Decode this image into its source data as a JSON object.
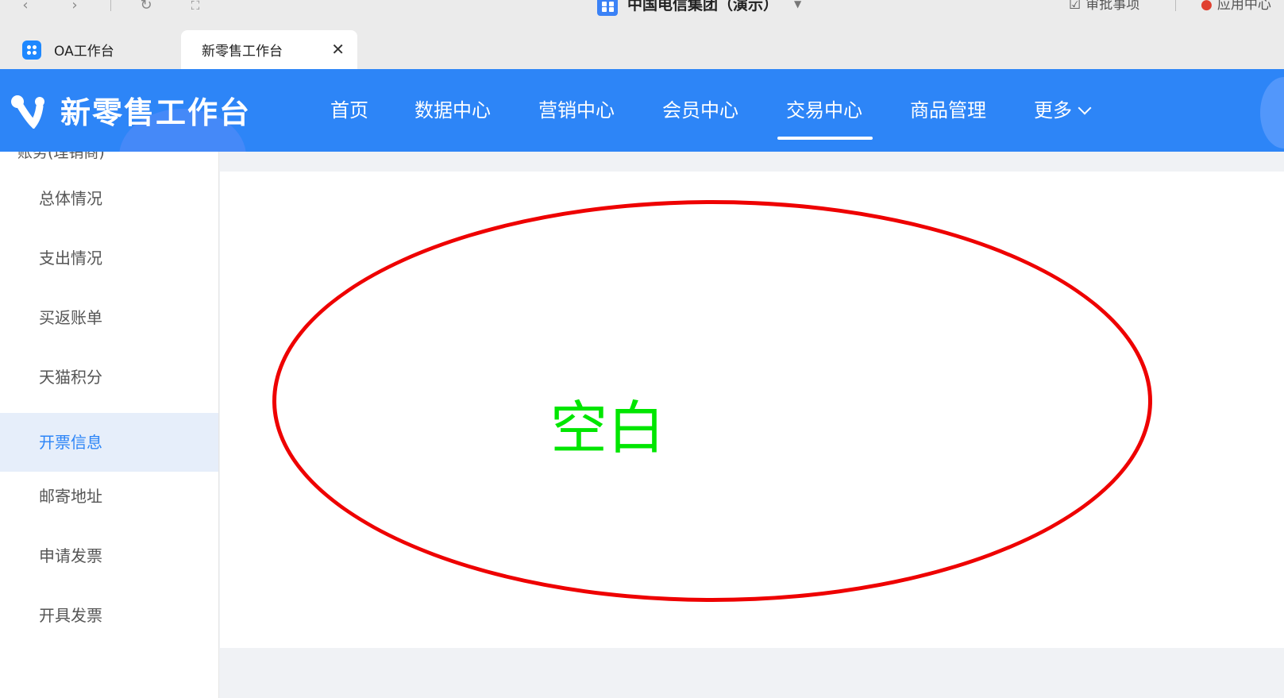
{
  "window": {
    "title": "中国电信集团（演示）",
    "right_items": [
      "审批事项",
      "应用中心"
    ]
  },
  "tabs": [
    {
      "label": "OA工作台",
      "active": false
    },
    {
      "label": "新零售工作台",
      "active": true
    }
  ],
  "header": {
    "app_name": "新零售工作台",
    "nav": [
      {
        "label": "首页"
      },
      {
        "label": "数据中心"
      },
      {
        "label": "营销中心"
      },
      {
        "label": "会员中心"
      },
      {
        "label": "交易中心",
        "active": true
      },
      {
        "label": "商品管理"
      },
      {
        "label": "更多"
      }
    ]
  },
  "sidebar": {
    "cut_off_label": "账务(理销商)",
    "items": [
      {
        "label": "总体情况"
      },
      {
        "label": "支出情况"
      },
      {
        "label": "买返账单"
      },
      {
        "label": "天猫积分"
      },
      {
        "label": "开票信息",
        "selected": true
      },
      {
        "label": "邮寄地址"
      },
      {
        "label": "申请发票"
      },
      {
        "label": "开具发票"
      }
    ]
  },
  "content": {
    "annotation_text": "空白",
    "annotation_color": "#00e600",
    "ellipse_color": "#ee0000"
  },
  "colors": {
    "brand_blue": "#2d85f7",
    "selected_bg": "#e6eefa"
  }
}
